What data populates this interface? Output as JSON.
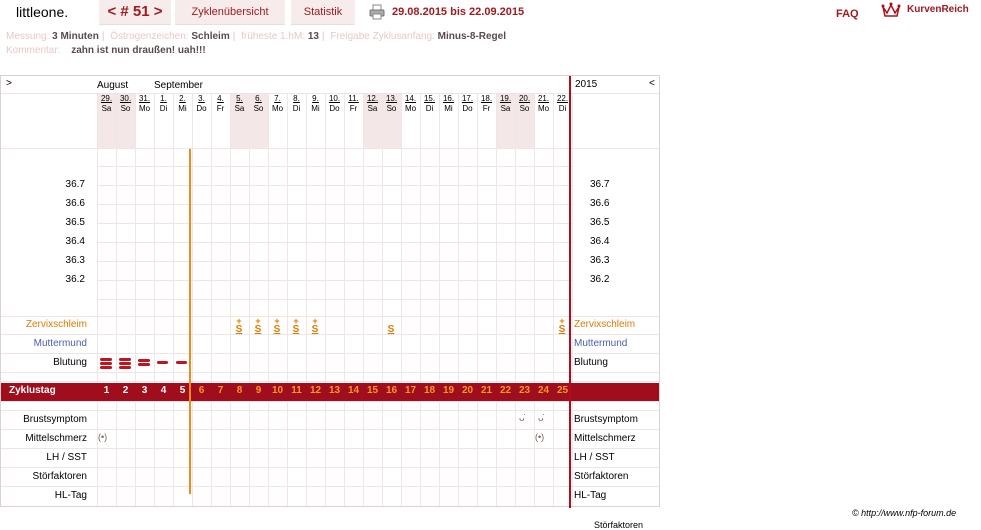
{
  "header": {
    "brand": "littleone.",
    "cycle_nav": "< # 51 >",
    "tab_overview": "Zyklenübersicht",
    "tab_stats": "Statistik",
    "date_range": "29.08.2015 bis 22.09.2015",
    "faq": "FAQ",
    "logo_text": "KurvenReich"
  },
  "info": {
    "messung_label": "Messung:",
    "messung_value": "3 Minuten",
    "oestrogen_label": "Östrogenzeichen:",
    "oestrogen_value": "Schleim",
    "fruehest_label": "früheste 1.hM:",
    "fruehest_value": "13",
    "freigabe_label": "Freigabe Zyklusanfang:",
    "freigabe_value": "Minus-8-Regel",
    "kommentar_label": "Kommentar:",
    "kommentar_value": "zahn ist nun draußen! uah!!!"
  },
  "chart_header": {
    "nav_left": ">",
    "nav_right": "<",
    "month1": "August",
    "month2": "September",
    "year": "2015"
  },
  "days": [
    {
      "d": "29.",
      "w": "Sa",
      "we": true
    },
    {
      "d": "30.",
      "w": "So",
      "we": true
    },
    {
      "d": "31.",
      "w": "Mo",
      "we": false
    },
    {
      "d": "1.",
      "w": "Di",
      "we": false
    },
    {
      "d": "2.",
      "w": "Mi",
      "we": false
    },
    {
      "d": "3.",
      "w": "Do",
      "we": false
    },
    {
      "d": "4.",
      "w": "Fr",
      "we": false
    },
    {
      "d": "5.",
      "w": "Sa",
      "we": true
    },
    {
      "d": "6.",
      "w": "So",
      "we": true
    },
    {
      "d": "7.",
      "w": "Mo",
      "we": false
    },
    {
      "d": "8.",
      "w": "Di",
      "we": false
    },
    {
      "d": "9.",
      "w": "Mi",
      "we": false
    },
    {
      "d": "10.",
      "w": "Do",
      "we": false
    },
    {
      "d": "11.",
      "w": "Fr",
      "we": false
    },
    {
      "d": "12.",
      "w": "Sa",
      "we": true
    },
    {
      "d": "13.",
      "w": "So",
      "we": true
    },
    {
      "d": "14.",
      "w": "Mo",
      "we": false
    },
    {
      "d": "15.",
      "w": "Di",
      "we": false
    },
    {
      "d": "16.",
      "w": "Mi",
      "we": false
    },
    {
      "d": "17.",
      "w": "Do",
      "we": false
    },
    {
      "d": "18.",
      "w": "Fr",
      "we": false
    },
    {
      "d": "19.",
      "w": "Sa",
      "we": true
    },
    {
      "d": "20.",
      "w": "So",
      "we": true
    },
    {
      "d": "21.",
      "w": "Mo",
      "we": false
    },
    {
      "d": "22.",
      "w": "Di",
      "we": false
    }
  ],
  "temperatures": [
    "36.7",
    "36.6",
    "36.5",
    "36.4",
    "36.3",
    "36.2"
  ],
  "rows": {
    "zervix": "Zervixschleim",
    "muttermund": "Muttermund",
    "blutung": "Blutung",
    "zyklustag": "Zyklustag",
    "brust": "Brustsymptom",
    "mittel": "Mittelschmerz",
    "lh": "LH / SST",
    "stoer": "Störfaktoren",
    "hl": "HL-Tag"
  },
  "cycle_days": [
    "1",
    "2",
    "3",
    "4",
    "5",
    "6",
    "7",
    "8",
    "9",
    "10",
    "11",
    "12",
    "13",
    "14",
    "15",
    "16",
    "17",
    "18",
    "19",
    "20",
    "21",
    "22",
    "23",
    "24",
    "25"
  ],
  "zervix_marks": [
    {
      "day": 8,
      "sym": "S",
      "plus": "+"
    },
    {
      "day": 9,
      "sym": "S",
      "plus": "+"
    },
    {
      "day": 10,
      "sym": "S",
      "plus": "+"
    },
    {
      "day": 11,
      "sym": "S",
      "plus": "+"
    },
    {
      "day": 12,
      "sym": "S",
      "plus": "+"
    },
    {
      "day": 16,
      "sym": "S",
      "plus": ""
    },
    {
      "day": 25,
      "sym": "S",
      "plus": "+"
    }
  ],
  "blutung_marks": [
    {
      "day": 1,
      "level": 3
    },
    {
      "day": 2,
      "level": 3
    },
    {
      "day": 3,
      "level": 2
    },
    {
      "day": 4,
      "level": 1
    },
    {
      "day": 5,
      "level": 1
    }
  ],
  "brust_marks": [
    {
      "day": 23,
      "sym": "ᴗ̇"
    },
    {
      "day": 24,
      "sym": "ᴗ̇"
    }
  ],
  "mittel_marks": [
    {
      "day": 1,
      "sym": "(•)"
    },
    {
      "day": 24,
      "sym": "(•)"
    }
  ],
  "footer": {
    "copyright": "© http://www.nfp-forum.de",
    "cut_text": "Störfaktoren"
  }
}
